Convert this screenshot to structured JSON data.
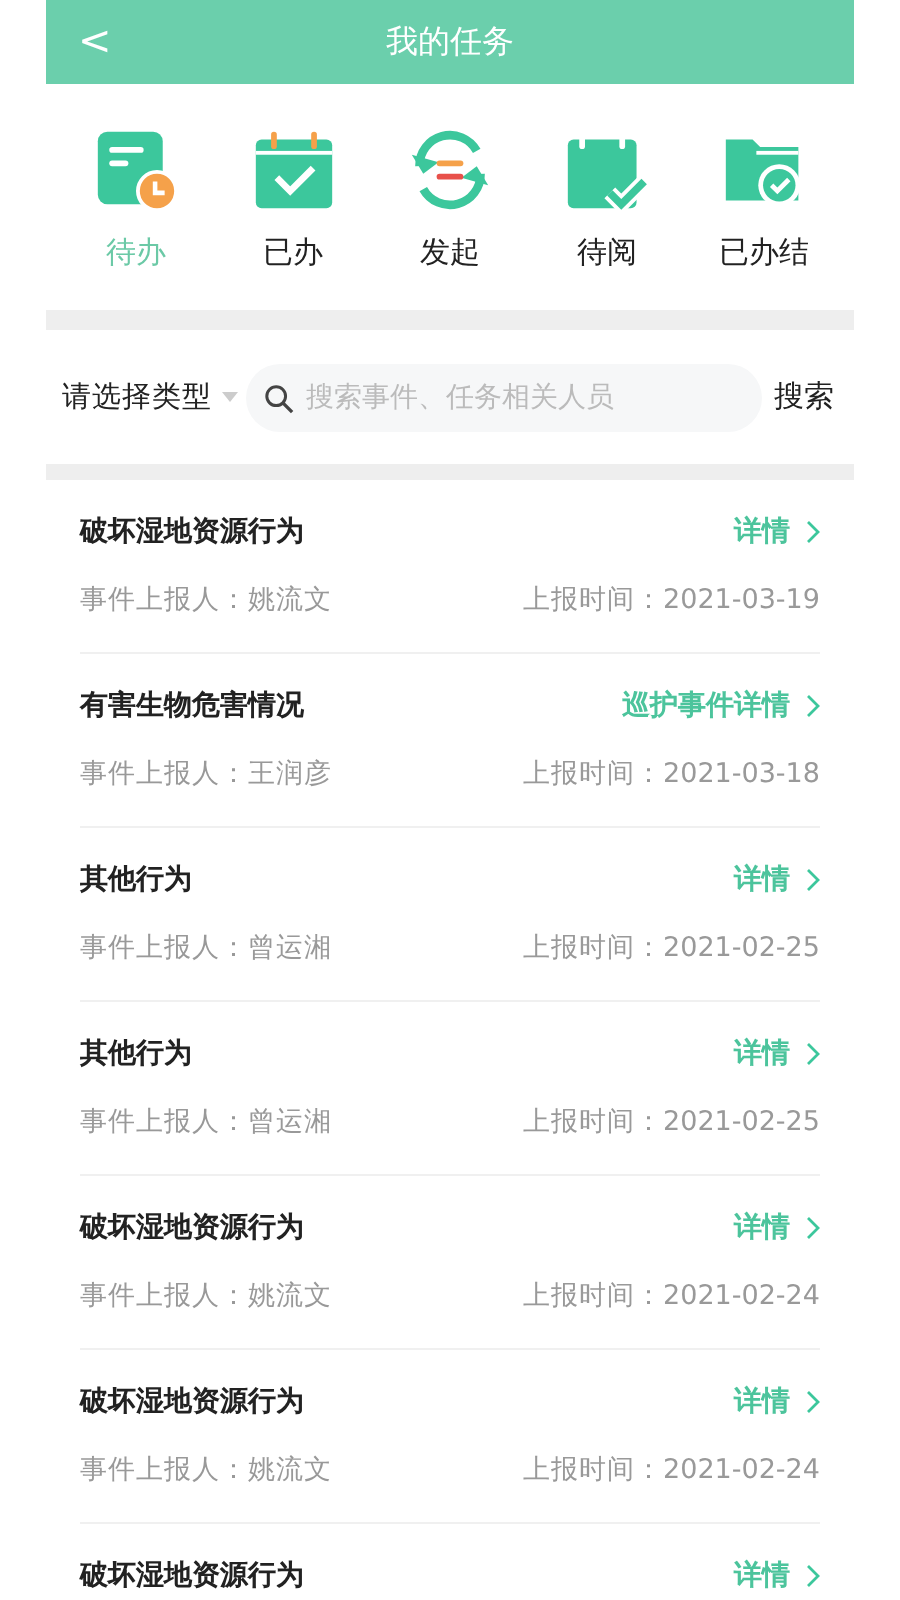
{
  "header": {
    "back": "<",
    "title": "我的任务"
  },
  "tabs": [
    {
      "label": "待办",
      "selected": true,
      "kind": "pending"
    },
    {
      "label": "已办",
      "selected": false,
      "kind": "done"
    },
    {
      "label": "发起",
      "selected": false,
      "kind": "initiate"
    },
    {
      "label": "待阅",
      "selected": false,
      "kind": "toread"
    },
    {
      "label": "已办结",
      "selected": false,
      "kind": "closed"
    }
  ],
  "search": {
    "type_select": "请选择类型",
    "placeholder": "搜索事件、任务相关人员",
    "button": "搜索"
  },
  "tasks": [
    {
      "title": "破坏湿地资源行为",
      "link": "详情",
      "reporter": "事件上报人：姚流文",
      "time": "上报时间：2021-03-19"
    },
    {
      "title": "有害生物危害情况",
      "link": "巡护事件详情",
      "reporter": "事件上报人：王润彦",
      "time": "上报时间：2021-03-18"
    },
    {
      "title": "其他行为",
      "link": "详情",
      "reporter": "事件上报人：曾运湘",
      "time": "上报时间：2021-02-25"
    },
    {
      "title": "其他行为",
      "link": "详情",
      "reporter": "事件上报人：曾运湘",
      "time": "上报时间：2021-02-25"
    },
    {
      "title": "破坏湿地资源行为",
      "link": "详情",
      "reporter": "事件上报人：姚流文",
      "time": "上报时间：2021-02-24"
    },
    {
      "title": "破坏湿地资源行为",
      "link": "详情",
      "reporter": "事件上报人：姚流文",
      "time": "上报时间：2021-02-24"
    },
    {
      "title": "破坏湿地资源行为",
      "link": "详情"
    }
  ]
}
